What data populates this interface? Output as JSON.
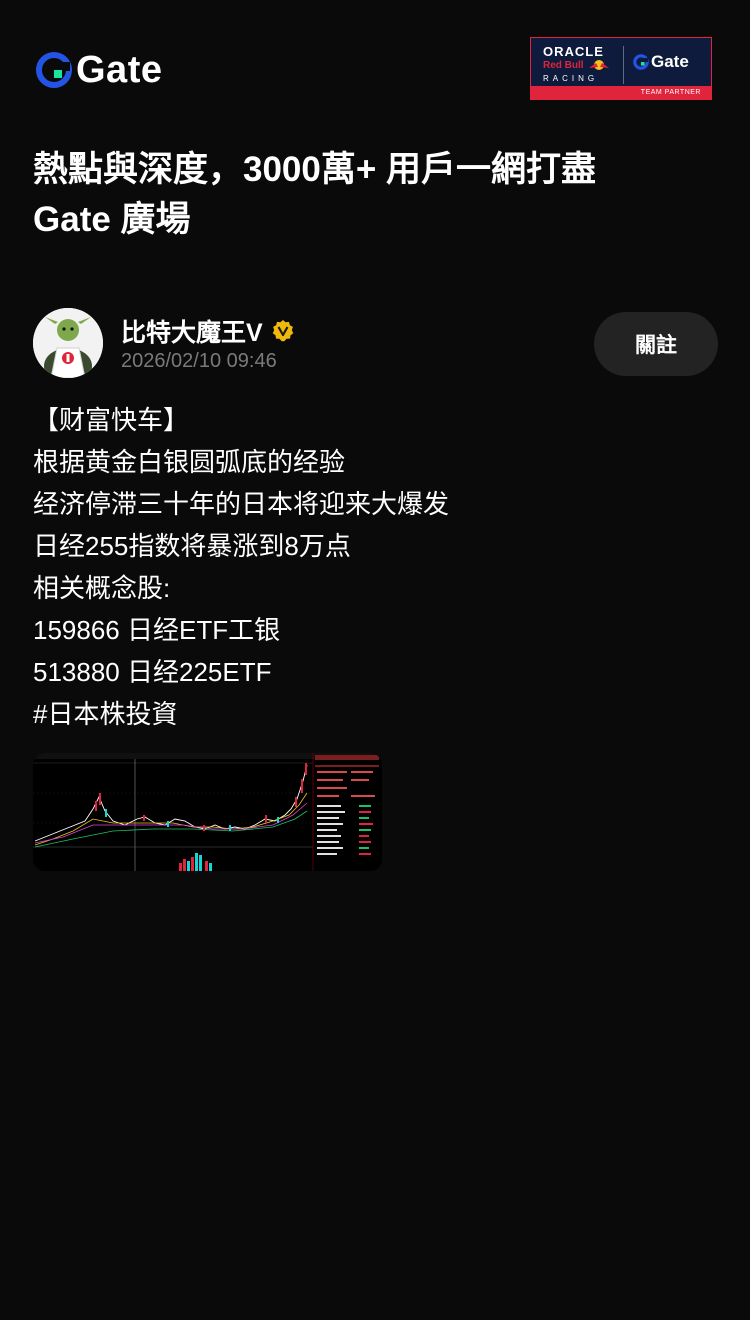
{
  "brand": {
    "name": "Gate",
    "accent": "#17e5a0",
    "blue": "#2354e6"
  },
  "partner": {
    "oracle": "ORACLE",
    "redbull": "Red Bull",
    "racing": "RACING",
    "gate": "Gate",
    "footer": "TEAM PARTNER"
  },
  "headline": {
    "line1": "熱點與深度，3000萬+ 用戶一網打盡",
    "line2": "Gate 廣場"
  },
  "author": {
    "name": "比特大魔王V",
    "time": "2026/02/10 09:46",
    "verified_color": "#f0b90b"
  },
  "follow": {
    "label": "關註"
  },
  "post": {
    "lines": [
      "【财富快车】",
      "根据黄金白银圆弧底的经验",
      "经济停滞三十年的日本将迎来大爆发",
      "日经255指数将暴涨到8万点",
      "相关概念股:",
      "159866  日经ETF工银",
      "513880  日经225ETF",
      "#日本株投資"
    ]
  },
  "icons": {
    "logo": "gate-logo-icon",
    "verified": "verified-badge-icon",
    "bull": "red-bull-icon"
  }
}
